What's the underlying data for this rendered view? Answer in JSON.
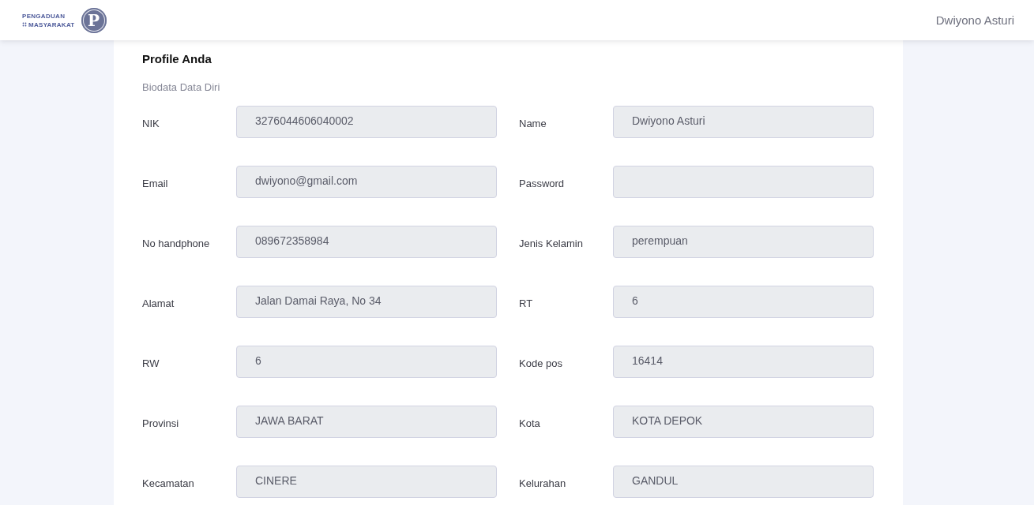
{
  "header": {
    "logo": {
      "line_1": "PENGADUAN",
      "line_2": "MASYARAKAT",
      "emblem_letter": "P"
    },
    "user_name": "Dwiyono Asturi"
  },
  "profile": {
    "title": "Profile Anda",
    "subtitle": "Biodata Data Diri",
    "fields": [
      {
        "label": "NIK",
        "value": "3276044606040002",
        "disabled": true
      },
      {
        "label": "Name",
        "value": "Dwiyono Asturi",
        "disabled": true
      },
      {
        "label": "Email",
        "value": "dwiyono@gmail.com",
        "disabled": true
      },
      {
        "label": "Password",
        "disabled": true
      },
      {
        "label": "No handphone",
        "value": "089672358984",
        "disabled": true
      },
      {
        "label": "Jenis Kelamin",
        "value": "perempuan",
        "disabled": true
      },
      {
        "label": "Alamat",
        "value": "Jalan Damai Raya, No 34",
        "disabled": true
      },
      {
        "label": "RT",
        "value": "6",
        "disabled": true
      },
      {
        "label": "RW",
        "value": "6",
        "disabled": true
      },
      {
        "label": "Kode pos",
        "value": "16414",
        "disabled": true
      },
      {
        "label": "Provinsi",
        "value": "JAWA BARAT",
        "disabled": true
      },
      {
        "label": "Kota",
        "value": "KOTA DEPOK",
        "disabled": true
      },
      {
        "label": "Kecamatan",
        "value": "CINERE",
        "disabled": true
      },
      {
        "label": "Kelurahan",
        "value": "GANDUL",
        "disabled": true
      }
    ]
  }
}
